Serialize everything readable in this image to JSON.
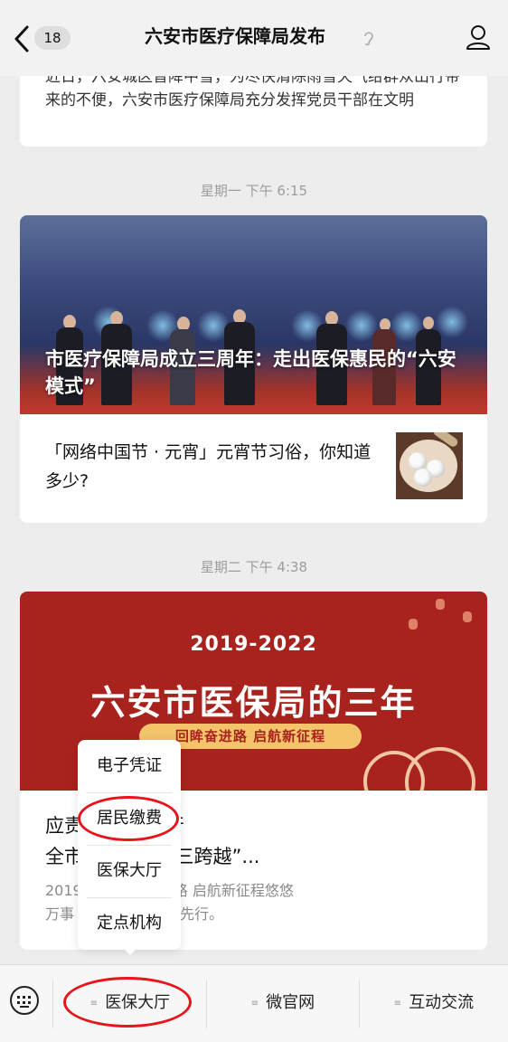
{
  "header": {
    "back_label": "<",
    "unread_count": "18",
    "title": "六安市医疗保障局发布"
  },
  "feed": {
    "top_card": {
      "partial_text": "近日，六安城区普降中雪，为尽快清除雨雪天气给群众出行带来的不便，六安市医疗保障局充分发挥党员干部在文明"
    },
    "timestamp_1": "星期一 下午 6:15",
    "article_1": {
      "cover_title": "市医疗保障局成立三周年：走出医保惠民的“六安模式”",
      "sub_title": "「网络中国节 · 元宵」元宵节习俗，你知道多少?"
    },
    "timestamp_2": "星期二 下午 4:38",
    "article_2": {
      "cover_year": "2019-2022",
      "cover_title": "六安市医保局的三年",
      "cover_slogan": "回眸奋进路  启航新征程",
      "title": "应责\t\t\t\t\t防民生而行\n全市\t\t\t\t实现“三年三跨越”...",
      "digest": "2019\t\t\t三年回眸奋进路  启航新征程悠悠\n万事\t\t\t\t关注民生，健康先行。"
    }
  },
  "popup_menu": {
    "items": [
      "电子凭证",
      "居民缴费",
      "医保大厅",
      "定点机构"
    ]
  },
  "bottom_bar": {
    "tabs": [
      {
        "label": "医保大厅"
      },
      {
        "label": "微官网"
      },
      {
        "label": "互动交流"
      }
    ],
    "menu_glyph": "≡"
  },
  "colors": {
    "annotation_red": "#e8141c",
    "cover_red": "#a8231d",
    "slogan_gold": "#f3c46a"
  },
  "icons": [
    "back-arrow-icon",
    "ear-icon",
    "profile-icon",
    "keyboard-icon",
    "menu-icon"
  ]
}
